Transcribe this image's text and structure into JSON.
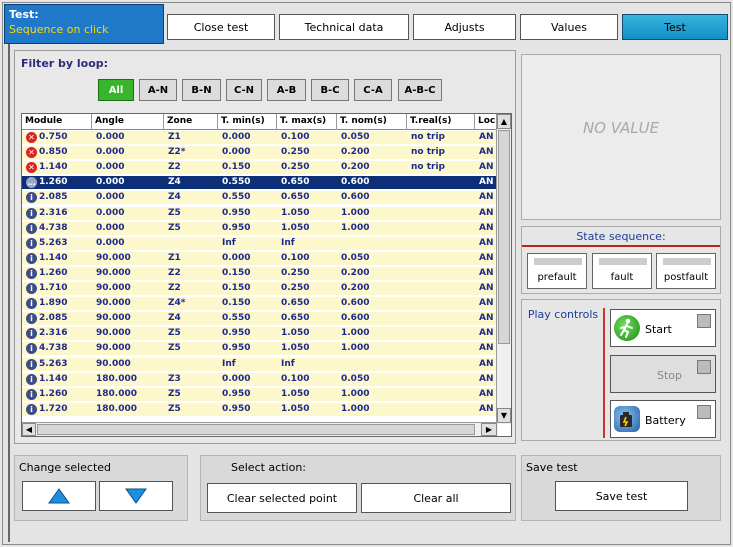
{
  "header": {
    "title": "Test:",
    "subtitle": "Sequence on click",
    "tabs": [
      {
        "label": "Close test",
        "active": false
      },
      {
        "label": "Technical data",
        "active": false
      },
      {
        "label": "Adjusts",
        "active": false
      },
      {
        "label": "Values",
        "active": false
      },
      {
        "label": "Test",
        "active": true
      }
    ]
  },
  "filter": {
    "label": "Filter by loop:",
    "options": [
      "All",
      "A-N",
      "B-N",
      "C-N",
      "A-B",
      "B-C",
      "C-A",
      "A-B-C"
    ],
    "selected": "All"
  },
  "table": {
    "columns": [
      "Module",
      "Angle",
      "Zone",
      "T. min(s)",
      "T. max(s)",
      "T. nom(s)",
      "T.real(s)",
      "Loc"
    ],
    "rows": [
      {
        "status": "error",
        "module": "0.750",
        "angle": "0.000",
        "zone": "Z1",
        "tmin": "0.000",
        "tmax": "0.100",
        "tnom": "0.050",
        "treal": "no trip",
        "loc": "AN"
      },
      {
        "status": "error",
        "module": "0.850",
        "angle": "0.000",
        "zone": "Z2*",
        "tmin": "0.000",
        "tmax": "0.250",
        "tnom": "0.200",
        "treal": "no trip",
        "loc": "AN"
      },
      {
        "status": "error",
        "module": "1.140",
        "angle": "0.000",
        "zone": "Z2",
        "tmin": "0.150",
        "tmax": "0.250",
        "tnom": "0.200",
        "treal": "no trip",
        "loc": "AN"
      },
      {
        "status": "pending",
        "module": "1.260",
        "angle": "0.000",
        "zone": "Z4",
        "tmin": "0.550",
        "tmax": "0.650",
        "tnom": "0.600",
        "treal": "",
        "loc": "AN",
        "selected": true
      },
      {
        "status": "info",
        "module": "2.085",
        "angle": "0.000",
        "zone": "Z4",
        "tmin": "0.550",
        "tmax": "0.650",
        "tnom": "0.600",
        "treal": "",
        "loc": "AN"
      },
      {
        "status": "info",
        "module": "2.316",
        "angle": "0.000",
        "zone": "Z5",
        "tmin": "0.950",
        "tmax": "1.050",
        "tnom": "1.000",
        "treal": "",
        "loc": "AN"
      },
      {
        "status": "info",
        "module": "4.738",
        "angle": "0.000",
        "zone": "Z5",
        "tmin": "0.950",
        "tmax": "1.050",
        "tnom": "1.000",
        "treal": "",
        "loc": "AN"
      },
      {
        "status": "info",
        "module": "5.263",
        "angle": "0.000",
        "zone": "",
        "tmin": "Inf",
        "tmax": "Inf",
        "tnom": "",
        "treal": "",
        "loc": "AN"
      },
      {
        "status": "info",
        "module": "1.140",
        "angle": "90.000",
        "zone": "Z1",
        "tmin": "0.000",
        "tmax": "0.100",
        "tnom": "0.050",
        "treal": "",
        "loc": "AN"
      },
      {
        "status": "info",
        "module": "1.260",
        "angle": "90.000",
        "zone": "Z2",
        "tmin": "0.150",
        "tmax": "0.250",
        "tnom": "0.200",
        "treal": "",
        "loc": "AN"
      },
      {
        "status": "info",
        "module": "1.710",
        "angle": "90.000",
        "zone": "Z2",
        "tmin": "0.150",
        "tmax": "0.250",
        "tnom": "0.200",
        "treal": "",
        "loc": "AN"
      },
      {
        "status": "info",
        "module": "1.890",
        "angle": "90.000",
        "zone": "Z4*",
        "tmin": "0.150",
        "tmax": "0.650",
        "tnom": "0.600",
        "treal": "",
        "loc": "AN"
      },
      {
        "status": "info",
        "module": "2.085",
        "angle": "90.000",
        "zone": "Z4",
        "tmin": "0.550",
        "tmax": "0.650",
        "tnom": "0.600",
        "treal": "",
        "loc": "AN"
      },
      {
        "status": "info",
        "module": "2.316",
        "angle": "90.000",
        "zone": "Z5",
        "tmin": "0.950",
        "tmax": "1.050",
        "tnom": "1.000",
        "treal": "",
        "loc": "AN"
      },
      {
        "status": "info",
        "module": "4.738",
        "angle": "90.000",
        "zone": "Z5",
        "tmin": "0.950",
        "tmax": "1.050",
        "tnom": "1.000",
        "treal": "",
        "loc": "AN"
      },
      {
        "status": "info",
        "module": "5.263",
        "angle": "90.000",
        "zone": "",
        "tmin": "Inf",
        "tmax": "Inf",
        "tnom": "",
        "treal": "",
        "loc": "AN"
      },
      {
        "status": "info",
        "module": "1.140",
        "angle": "180.000",
        "zone": "Z3",
        "tmin": "0.000",
        "tmax": "0.100",
        "tnom": "0.050",
        "treal": "",
        "loc": "AN"
      },
      {
        "status": "info",
        "module": "1.260",
        "angle": "180.000",
        "zone": "Z5",
        "tmin": "0.950",
        "tmax": "1.050",
        "tnom": "1.000",
        "treal": "",
        "loc": "AN"
      },
      {
        "status": "info",
        "module": "1.720",
        "angle": "180.000",
        "zone": "Z5",
        "tmin": "0.950",
        "tmax": "1.050",
        "tnom": "1.000",
        "treal": "",
        "loc": "AN"
      }
    ]
  },
  "right": {
    "no_value": "NO VALUE",
    "state_sequence": {
      "title": "State sequence:",
      "steps": [
        "prefault",
        "fault",
        "postfault"
      ]
    },
    "play": {
      "title": "Play controls",
      "start": "Start",
      "stop": "Stop",
      "battery": "Battery"
    }
  },
  "bottom": {
    "change_selected": "Change selected",
    "select_action": "Select action:",
    "clear_selected": "Clear selected point",
    "clear_all": "Clear all",
    "save_test_label": "Save test",
    "save_test_button": "Save test"
  },
  "colors": {
    "accent": "#1f78c8",
    "active_tab": "#1ba3d6",
    "row_bg": "#fdf8cc",
    "row_selected": "#0d2f78",
    "all_button": "#38b52c",
    "error": "#d22222"
  }
}
